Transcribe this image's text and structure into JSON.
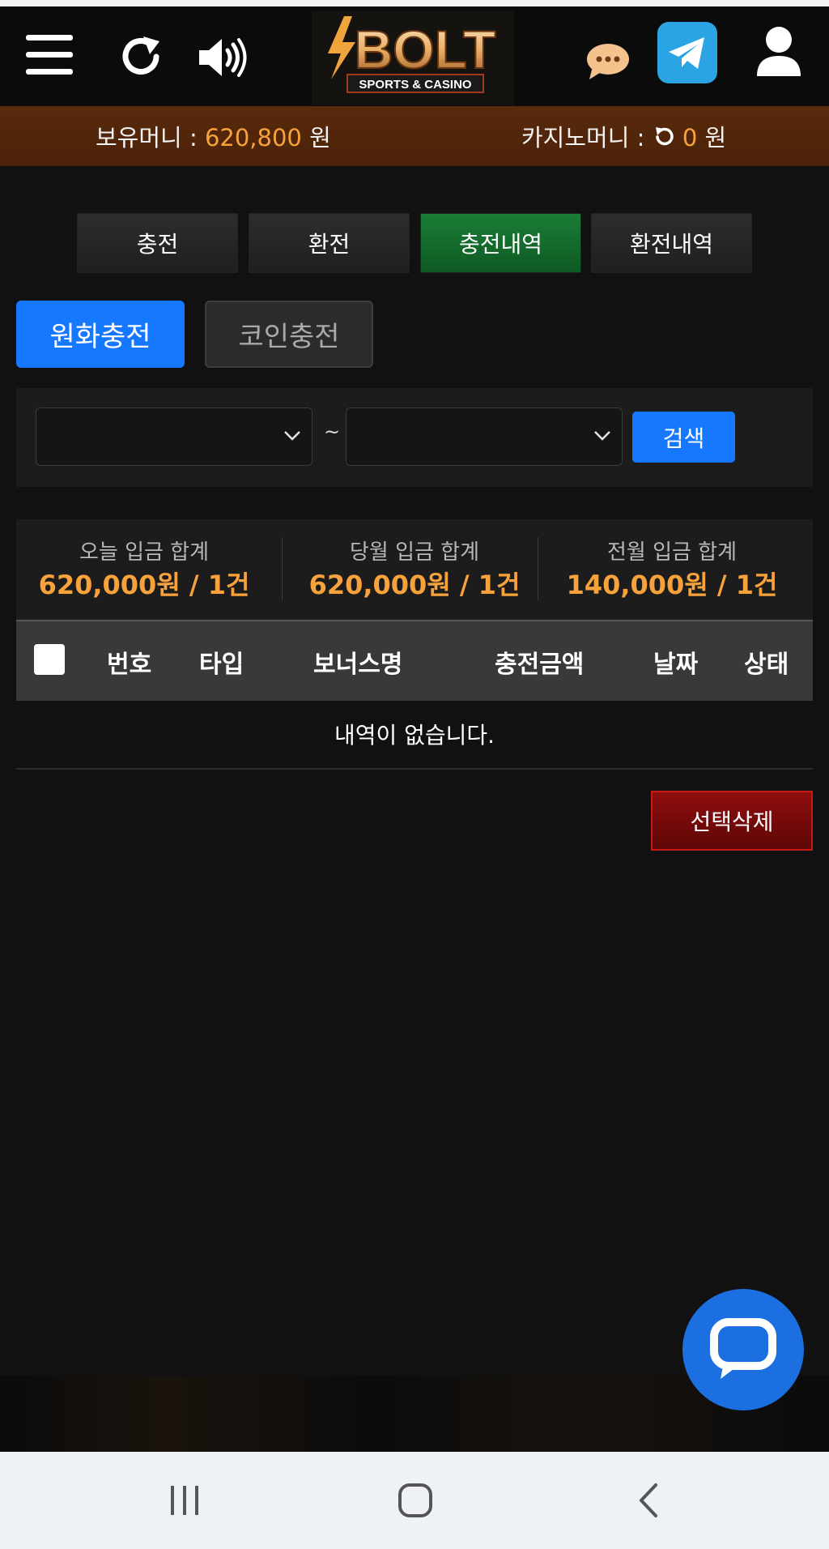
{
  "header": {
    "menu_icon": "hamburger-menu-icon",
    "refresh_icon": "refresh-icon",
    "sound_icon": "speaker-icon",
    "logo_title": "BOLT",
    "logo_subtitle": "SPORTS & CASINO",
    "chat_icon": "chat-bubble-icon",
    "telegram_icon": "telegram-icon",
    "user_icon": "user-icon",
    "colors": {
      "logo_gold": "#e9b068",
      "chat_icon": "#f4c28d",
      "telegram": "#2aa4e3"
    }
  },
  "balance": {
    "label": "보유머니 :",
    "amount": "620,800",
    "unit": "원"
  },
  "casino": {
    "label": "카지노머니 :",
    "refresh_icon": "refresh-icon",
    "amount": "0",
    "unit": "원"
  },
  "tabs": [
    {
      "label": "충전",
      "active": false
    },
    {
      "label": "환전",
      "active": false
    },
    {
      "label": "충전내역",
      "active": true
    },
    {
      "label": "환전내역",
      "active": false
    }
  ],
  "subtabs": [
    {
      "label": "원화충전",
      "active": true
    },
    {
      "label": "코인충전",
      "active": false
    }
  ],
  "filter": {
    "start_value": "",
    "tilde": "~",
    "end_value": "",
    "search_label": "검색"
  },
  "summary": [
    {
      "label": "오늘 입금 합계",
      "value": "620,000원 / 1건"
    },
    {
      "label": "당월 입금 합계",
      "value": "620,000원 / 1건"
    },
    {
      "label": "전월 입금 합계",
      "value": "140,000원 / 1건"
    }
  ],
  "table": {
    "columns": [
      "번호",
      "타입",
      "보너스명",
      "충전금액",
      "날짜",
      "상태"
    ],
    "rows": [],
    "empty_text": "내역이 없습니다."
  },
  "delete_label": "선택삭제",
  "colors": {
    "accent_blue": "#1677ff",
    "active_tab_green": "#1a7d36",
    "amount_orange": "#f7a23b",
    "delete_red": "#8e0e0e"
  },
  "chat_fab_icon": "chat-support-icon",
  "navbar": {
    "recent_icon": "recent-apps-icon",
    "home_icon": "home-icon",
    "back_icon": "back-icon"
  }
}
